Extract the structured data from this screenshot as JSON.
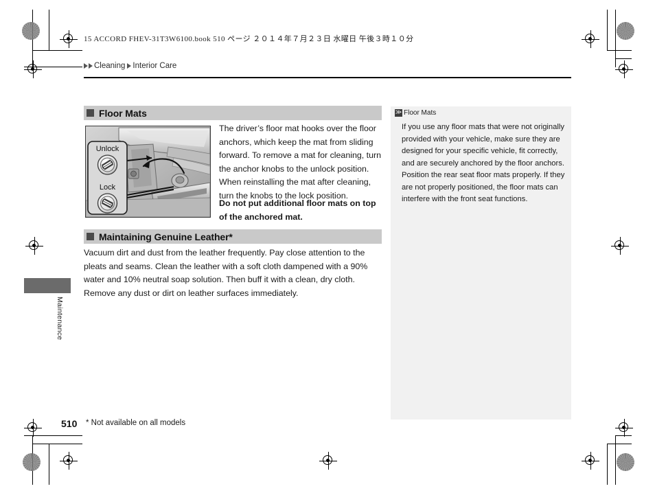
{
  "header": {
    "meta_line": "15 ACCORD FHEV-31T3W6100.book   510 ページ   ２０１４年７月２３日   水曜日   午後３時１０分"
  },
  "breadcrumb": {
    "level1": "Cleaning",
    "level2": "Interior Care"
  },
  "side_tab": {
    "label": "Maintenance"
  },
  "sections": [
    {
      "id": "floor-mats",
      "title": "Floor Mats",
      "bullet_icon": "filled-square-icon"
    },
    {
      "id": "maintaining-genuine-leather",
      "title": "Maintaining Genuine Leather*",
      "bullet_icon": "filled-square-icon"
    }
  ],
  "main": {
    "floor_mats_paragraph": "The driver’s floor mat hooks over the floor anchors, which keep the mat from sliding forward. To remove a mat for cleaning, turn the anchor knobs to the unlock position. When reinstalling the mat after cleaning, turn the knobs to the lock position.",
    "floor_mats_warning": "Do not put additional floor mats on top of the anchored mat.",
    "leather_paragraph": "Vacuum dirt and dust from the leather frequently. Pay close attention to the pleats and seams. Clean the leather with a soft cloth dampened with a 90% water and 10% neutral soap solution. Then buff it with a clean, dry cloth. Remove any dust or dirt on leather surfaces immediately."
  },
  "illustration": {
    "name": "floor-mat-anchor-illustration",
    "callout_unlock_label": "Unlock",
    "callout_lock_label": "Lock"
  },
  "note_panel": {
    "icon": "double-chevron-icon",
    "icon_glyph": "≫",
    "title": "Floor Mats",
    "paragraph_1": "If you use any floor mats that were not originally provided with your vehicle, make sure they are designed for your specific vehicle, fit correctly, and are securely anchored by the floor anchors.",
    "paragraph_2": "Position the rear seat floor mats properly. If they are not properly positioned, the floor mats can interfere with the front seat functions."
  },
  "footer": {
    "page_number": "510",
    "footnote": "* Not available on all models"
  },
  "colors": {
    "section_header_bg": "#c9c9c9",
    "section_bullet": "#4a4a4a",
    "note_panel_bg": "#f1f1f1",
    "side_tab_block": "#6b6b6b",
    "text": "#1a1a1a"
  }
}
